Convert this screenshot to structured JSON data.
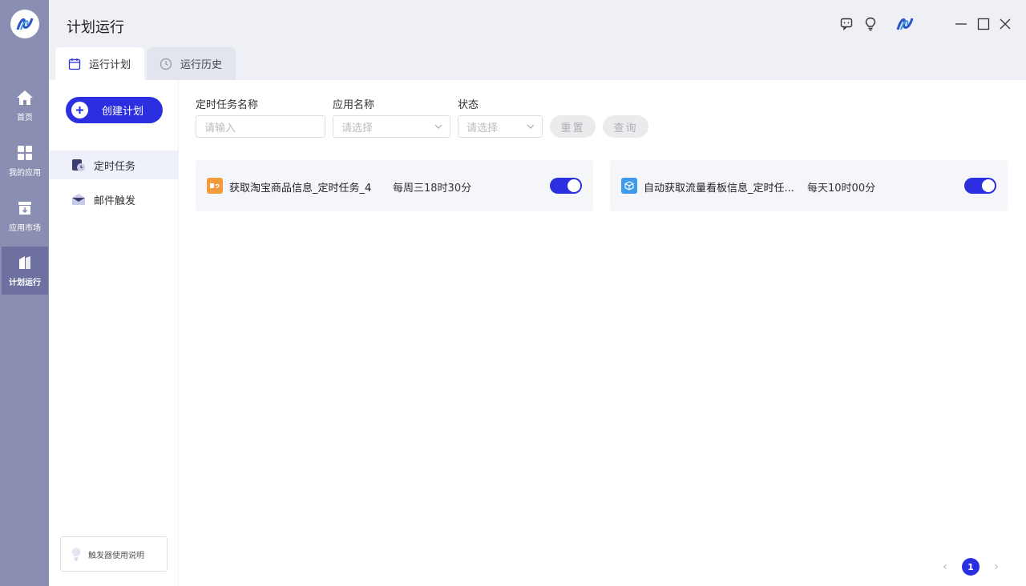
{
  "app": {
    "title": "计划运行",
    "colors": {
      "accent": "#2b2fe0",
      "rail": "#8b8eb3",
      "rail_active": "#6e71a0"
    }
  },
  "rail": {
    "items": [
      {
        "label": "首页",
        "icon": "home-icon"
      },
      {
        "label": "我的应用",
        "icon": "apps-grid-icon"
      },
      {
        "label": "应用市场",
        "icon": "store-icon"
      },
      {
        "label": "计划运行",
        "icon": "schedule-run-icon",
        "active": true
      }
    ]
  },
  "header": {
    "icons": [
      "chat-icon",
      "lightbulb-icon",
      "avatar-logo-icon",
      "minimize-icon",
      "maximize-icon",
      "close-icon"
    ]
  },
  "tabs": [
    {
      "label": "运行计划",
      "icon": "calendar-icon",
      "active": true
    },
    {
      "label": "运行历史",
      "icon": "clock-icon",
      "active": false
    }
  ],
  "subnav": {
    "create_label": "创建计划",
    "items": [
      {
        "label": "定时任务",
        "icon": "timer-task-icon",
        "active": true
      },
      {
        "label": "邮件触发",
        "icon": "mail-trigger-icon",
        "active": false
      }
    ],
    "help_label": "触发器使用说明"
  },
  "filters": {
    "task_name_label": "定时任务名称",
    "task_name_placeholder": "请输入",
    "app_name_label": "应用名称",
    "app_name_placeholder": "请选择",
    "status_label": "状态",
    "status_placeholder": "请选择",
    "reset_label": "重置",
    "query_label": "查询"
  },
  "tasks": [
    {
      "name": "获取淘宝商品信息_定时任务_4",
      "schedule": "每周三18时30分",
      "enabled": true,
      "icon_color": "#f39a3b"
    },
    {
      "name": "自动获取流量看板信息_定时任...",
      "schedule": "每天10时00分",
      "enabled": true,
      "icon_color": "#3d9be9"
    }
  ],
  "pagination": {
    "current": "1",
    "prev": "‹",
    "next": "›"
  }
}
